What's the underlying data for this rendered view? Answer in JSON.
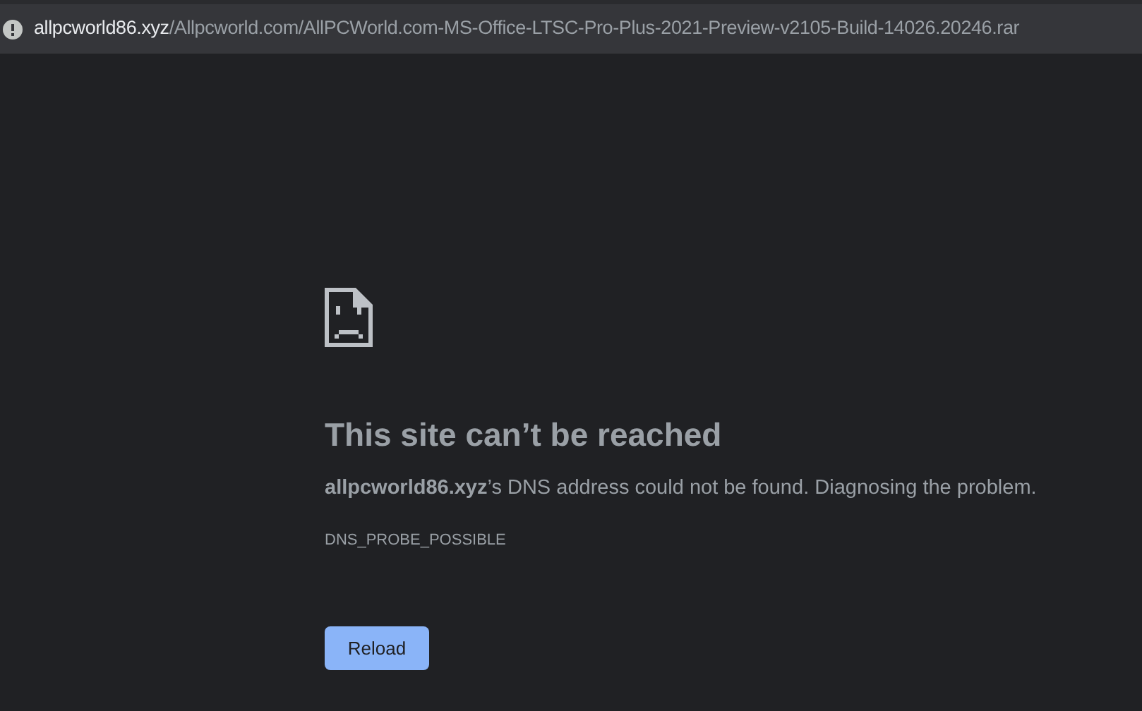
{
  "address_bar": {
    "host": "allpcworld86.xyz",
    "path": "/Allpcworld.com/AllPCWorld.com-MS-Office-LTSC-Pro-Plus-2021-Preview-v2105-Build-14026.20246.rar"
  },
  "error": {
    "title": "This site can’t be reached",
    "message": "**allpcworld86.xyz**’s DNS address could not be found. Diagnosing the problem.",
    "code": "DNS_PROBE_POSSIBLE",
    "button": "Reload"
  }
}
